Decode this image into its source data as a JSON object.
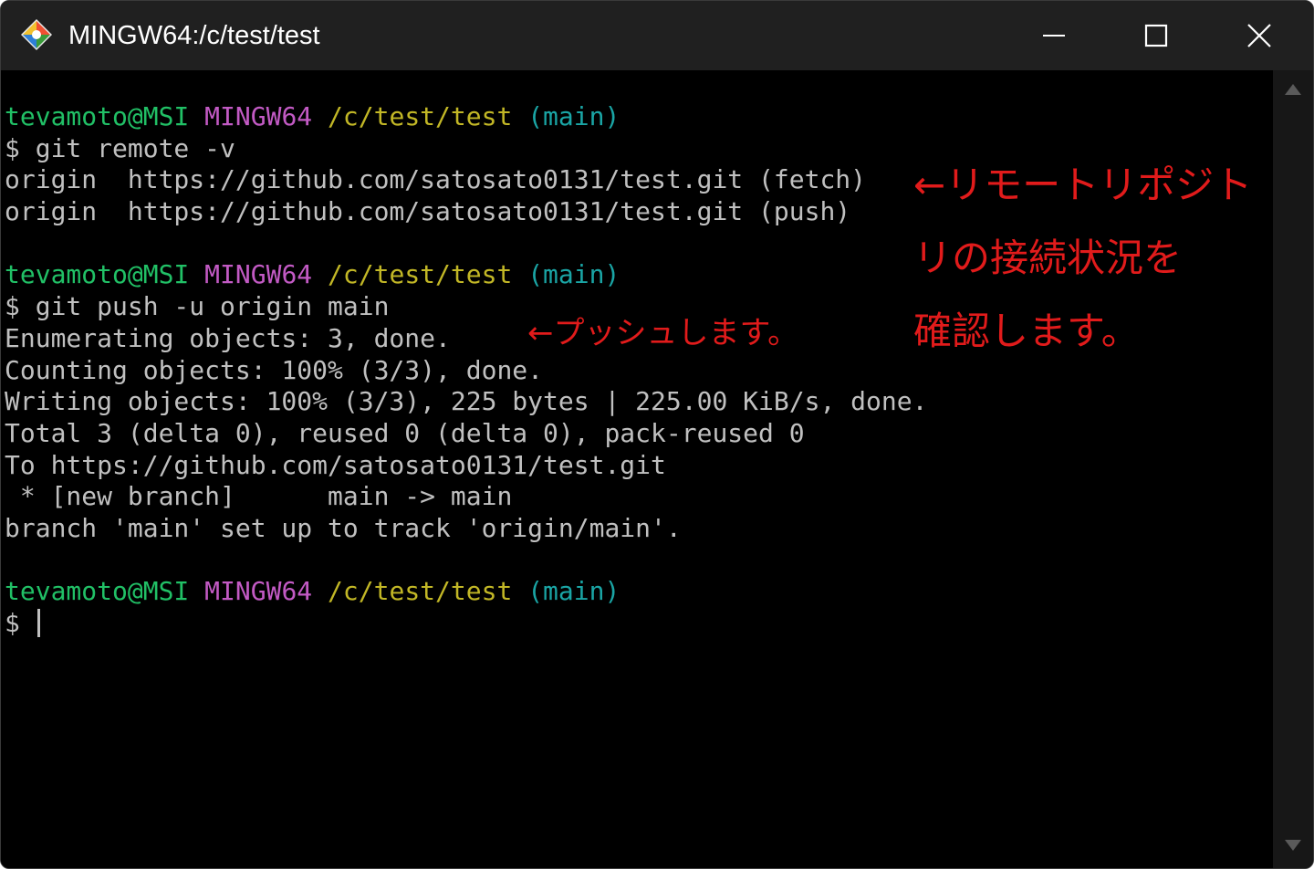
{
  "window": {
    "title": "MINGW64:/c/test/test",
    "icon": "git-bash-icon",
    "controls": {
      "minimize_icon": "minimize-icon",
      "maximize_icon": "maximize-icon",
      "close_icon": "close-icon"
    }
  },
  "terminal": {
    "colors": {
      "background": "#000000",
      "text": "#c0c0c0",
      "user": "#21c066",
      "mingw": "#c25ac4",
      "path": "#c2b726",
      "branch": "#1aa5a5"
    },
    "prompt": {
      "user": "tevamoto@MSI",
      "env": "MINGW64",
      "path": "/c/test/test",
      "branch": "(main)",
      "symbol": "$"
    },
    "block1": {
      "command": "$ git remote -v",
      "output": [
        "origin  https://github.com/satosato0131/test.git (fetch)",
        "origin  https://github.com/satosato0131/test.git (push)"
      ]
    },
    "block2": {
      "command": "$ git push -u origin main",
      "output": [
        "Enumerating objects: 3, done.",
        "Counting objects: 100% (3/3), done.",
        "Writing objects: 100% (3/3), 225 bytes | 225.00 KiB/s, done.",
        "Total 3 (delta 0), reused 0 (delta 0), pack-reused 0",
        "To https://github.com/satosato0131/test.git",
        " * [new branch]      main -> main",
        "branch 'main' set up to track 'origin/main'."
      ]
    },
    "block3": {
      "command": "$ "
    }
  },
  "annotations": {
    "color": "#e11b1b",
    "push": "←プッシュします。",
    "remote": [
      "←リモートリポジト",
      "リの接続状況を",
      "確認します。"
    ]
  }
}
